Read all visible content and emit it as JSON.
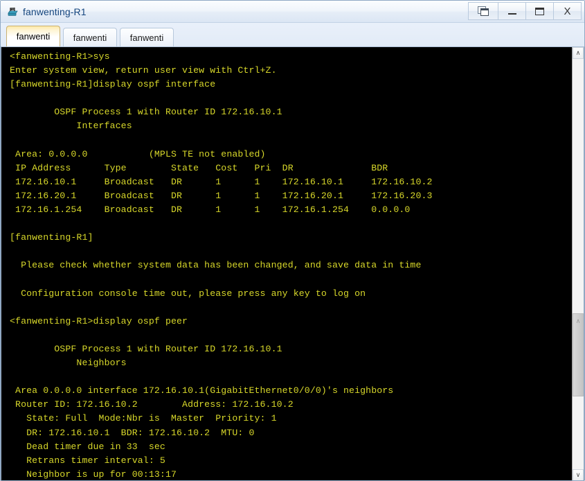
{
  "window": {
    "title": "fanwenting-R1",
    "icon": "router-icon",
    "controls": {
      "cascade_label": "",
      "minimize_label": "",
      "maximize_label": "",
      "close_label": "X"
    }
  },
  "tabs": [
    {
      "label": "fanwenti",
      "active": true
    },
    {
      "label": "fanwenti",
      "active": false
    },
    {
      "label": "fanwenti",
      "active": false
    }
  ],
  "terminal": {
    "foreground_color": "#d8d82a",
    "background_color": "#000000",
    "lines": [
      "<fanwenting-R1>sys",
      "Enter system view, return user view with Ctrl+Z.",
      "[fanwenting-R1]display ospf interface",
      "",
      "        OSPF Process 1 with Router ID 172.16.10.1",
      "            Interfaces",
      "",
      " Area: 0.0.0.0           (MPLS TE not enabled)",
      " IP Address      Type        State   Cost   Pri  DR              BDR",
      " 172.16.10.1     Broadcast   DR      1      1    172.16.10.1     172.16.10.2",
      " 172.16.20.1     Broadcast   DR      1      1    172.16.20.1     172.16.20.3",
      " 172.16.1.254    Broadcast   DR      1      1    172.16.1.254    0.0.0.0",
      "",
      "[fanwenting-R1]",
      "",
      "  Please check whether system data has been changed, and save data in time",
      "",
      "  Configuration console time out, please press any key to log on",
      "",
      "<fanwenting-R1>display ospf peer",
      "",
      "        OSPF Process 1 with Router ID 172.16.10.1",
      "            Neighbors",
      "",
      " Area 0.0.0.0 interface 172.16.10.1(GigabitEthernet0/0/0)'s neighbors",
      " Router ID: 172.16.10.2        Address: 172.16.10.2",
      "   State: Full  Mode:Nbr is  Master  Priority: 1",
      "   DR: 172.16.10.1  BDR: 172.16.10.2  MTU: 0",
      "   Dead timer due in 33  sec",
      "   Retrans timer interval: 5",
      "   Neighbor is up for 00:13:17"
    ]
  },
  "scrollbar": {
    "up_arrow": "∧",
    "down_arrow": "∨",
    "thumb_grip": "∧"
  }
}
